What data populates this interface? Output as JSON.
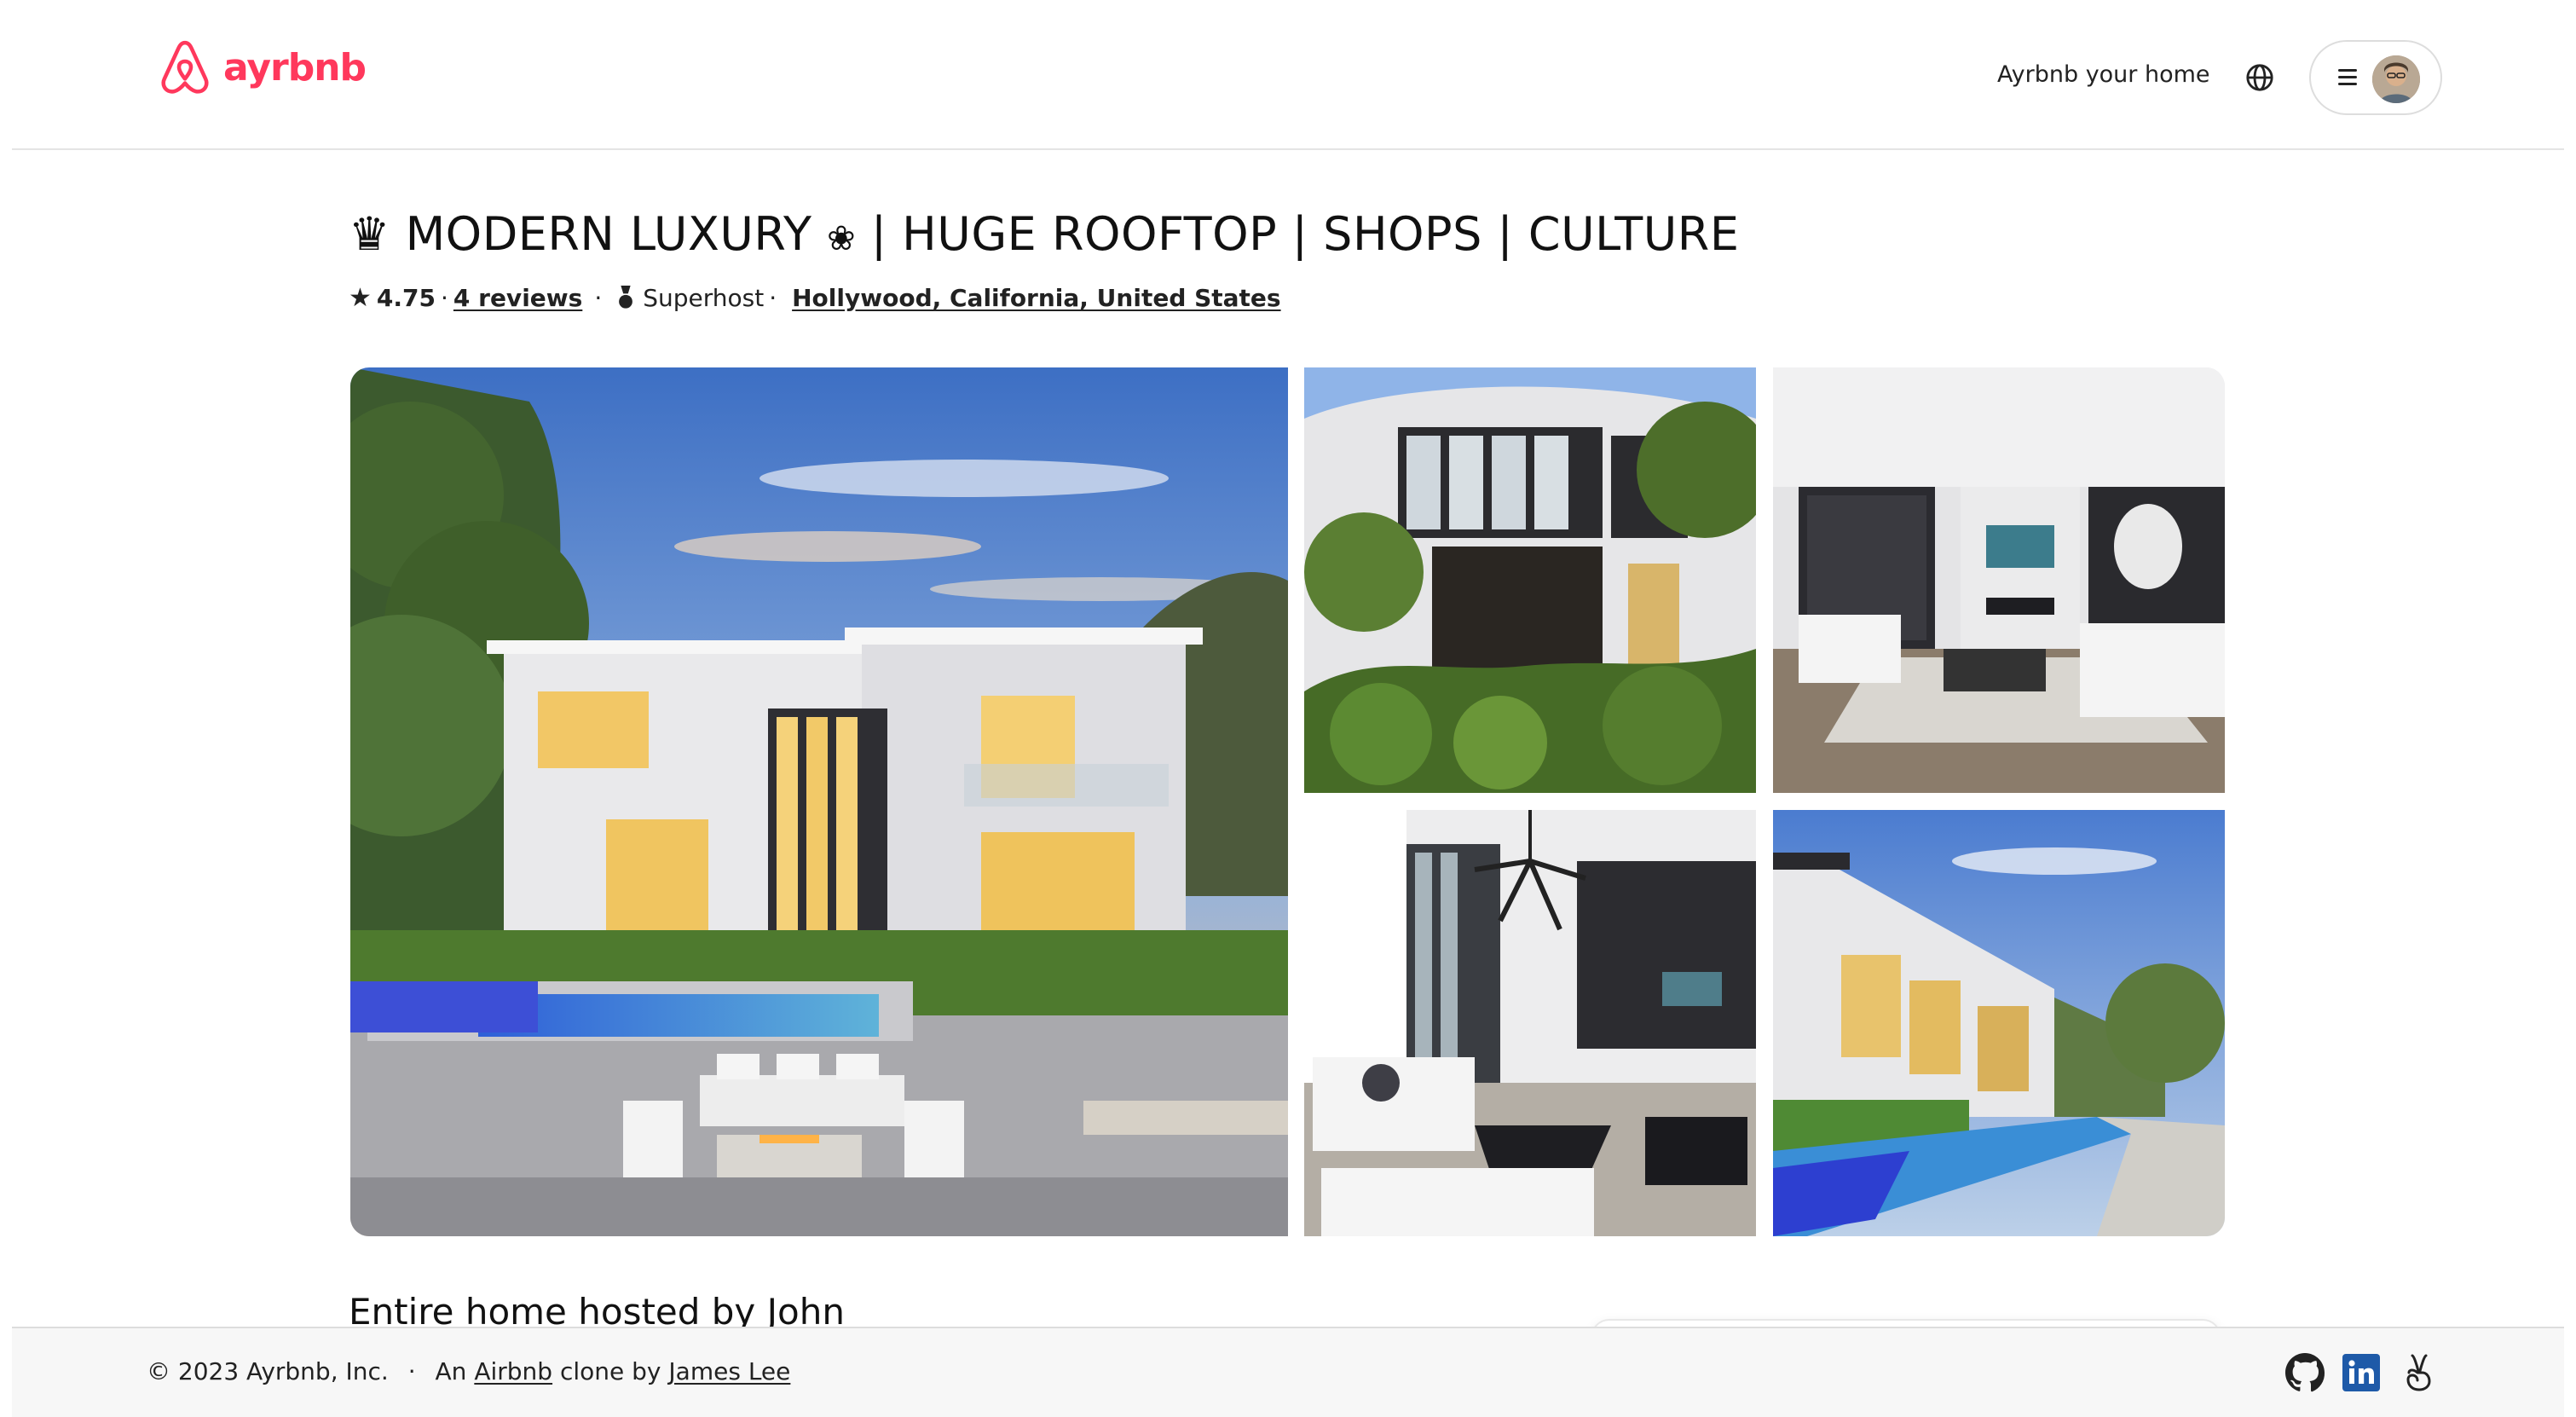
{
  "header": {
    "brand": "ayrbnb",
    "host_link": "Ayrbnb your home",
    "brand_color": "#ff385c"
  },
  "listing": {
    "title_prefix_icon": "♛",
    "title_part1": "MODERN LUXURY",
    "title_mid_icon": "❀",
    "title_part2": "| HUGE ROOFTOP | SHOPS | CULTURE",
    "rating": "4.75",
    "rating_sep": "·",
    "reviews": "4 reviews",
    "dot": "·",
    "superhost": "Superhost",
    "superhost_sep": "·",
    "location": "Hollywood, California, United States"
  },
  "photos": [
    {
      "alt": "Exterior with pool at dusk"
    },
    {
      "alt": "Front facade with vertical garden"
    },
    {
      "alt": "Living room with fireplace"
    },
    {
      "alt": "Living room with chandelier"
    },
    {
      "alt": "Pool and house side view"
    }
  ],
  "section": {
    "title": "Entire home hosted by John"
  },
  "footer": {
    "copyright": "© 2023 Ayrbnb, Inc.",
    "dot": "·",
    "an": "An",
    "airbnb_link": "Airbnb",
    "clone_by": "clone by",
    "author_link": "James Lee"
  },
  "icons": {
    "logo": "airbnb-logo-icon",
    "globe": "globe-icon",
    "menu": "hamburger-menu-icon",
    "star": "star-icon",
    "medal": "superhost-medal-icon",
    "github": "github-icon",
    "linkedin": "linkedin-icon",
    "angellist": "angellist-icon"
  }
}
